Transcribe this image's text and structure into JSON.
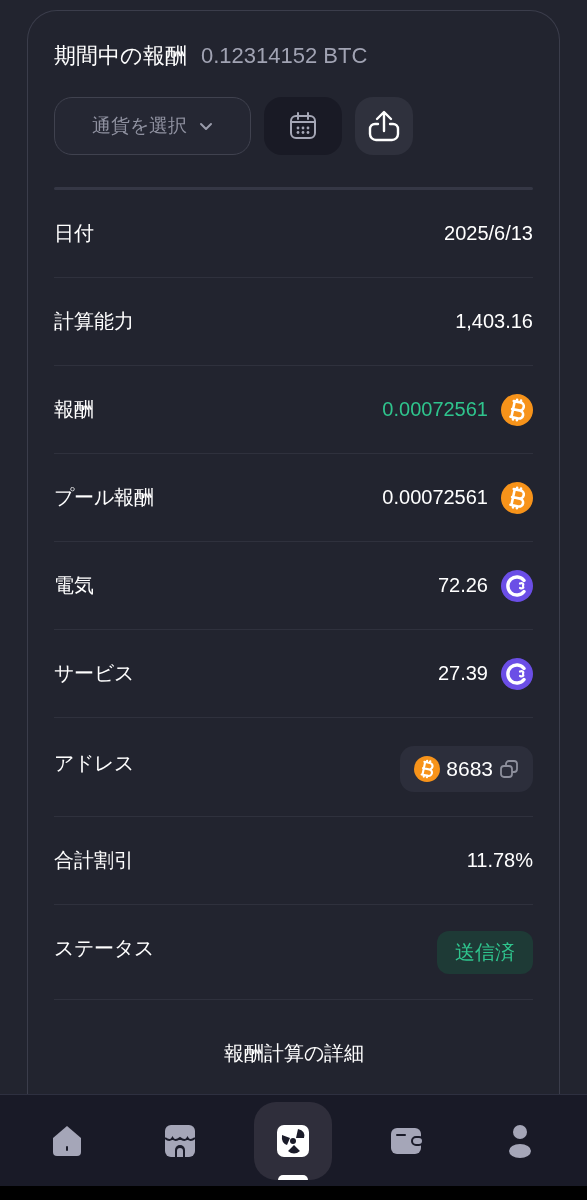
{
  "header": {
    "title": "期間中の報酬",
    "total": "0.12314152 BTC"
  },
  "controls": {
    "currency_select": "通貨を選択"
  },
  "rows": [
    {
      "kind": "plain",
      "label": "日付",
      "value": "2025/6/13",
      "highlighted": false
    },
    {
      "kind": "plain",
      "label": "計算能力",
      "value": "1,403.16",
      "highlighted": false
    },
    {
      "kind": "amount",
      "label": "報酬",
      "value": "0.00072561",
      "icon": {
        "kind": "btc"
      },
      "highlighted": true
    },
    {
      "kind": "amount",
      "label": "プール報酬",
      "value": "0.00072561",
      "icon": {
        "kind": "btc"
      },
      "highlighted": false
    },
    {
      "kind": "amount",
      "label": "電気",
      "value": "72.26",
      "icon": {
        "kind": "token"
      },
      "highlighted": false
    },
    {
      "kind": "amount",
      "label": "サービス",
      "value": "27.39",
      "icon": {
        "kind": "token"
      },
      "highlighted": false
    },
    {
      "kind": "address",
      "label": "アドレス",
      "value": "8683",
      "icon": {
        "kind": "btc"
      },
      "highlighted": false
    },
    {
      "kind": "plain",
      "label": "合計割引",
      "value": "11.78%",
      "highlighted": false
    },
    {
      "kind": "status",
      "label": "ステータス",
      "value": "送信済",
      "highlighted": false
    }
  ],
  "details_link": "報酬計算の詳細",
  "nav": [
    {
      "selected": false
    },
    {
      "selected": false
    },
    {
      "selected": true
    },
    {
      "selected": false
    },
    {
      "selected": false
    }
  ]
}
